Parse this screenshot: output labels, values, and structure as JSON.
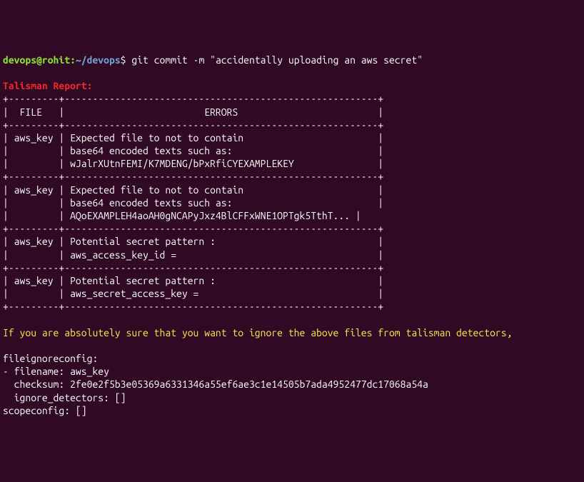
{
  "prompt": {
    "userHost": "devops@rohit",
    "separator": ":",
    "path": "~/devops",
    "dollar": "$ ",
    "command": "git commit -m \"accidentally uploading an aws secret\""
  },
  "report": {
    "header": "Talisman Report:",
    "tableLines": [
      "+---------+--------------------------------------------------------+",
      "|  FILE   |                         ERRORS                         |",
      "+---------+--------------------------------------------------------+",
      "| aws_key | Expected file to not to contain                        |",
      "|         | base64 encoded texts such as:                          |",
      "|         | wJalrXUtnFEMI/K7MDENG/bPxRfiCYEXAMPLEKEY               |",
      "+---------+--------------------------------------------------------+",
      "| aws_key | Expected file to not to contain                        |",
      "|         | base64 encoded texts such as:                          |",
      "|         | AQoEXAMPLEH4aoAH0gNCAPyJxz4BlCFFxWNE1OPTgk5TthT... |",
      "+---------+--------------------------------------------------------+",
      "| aws_key | Potential secret pattern :                             |",
      "|         | aws_access_key_id =                                    |",
      "+---------+--------------------------------------------------------+",
      "| aws_key | Potential secret pattern :                             |",
      "|         | aws_secret_access_key =                                |",
      "+---------+--------------------------------------------------------+"
    ]
  },
  "warning": "If you are absolutely sure that you want to ignore the above files from talisman detectors,",
  "config": {
    "lines": [
      "fileignoreconfig:",
      "- filename: aws_key",
      "  checksum: 2fe0e2f5b3e05369a6331346a55ef6ae3c1e14505b7ada4952477dc17068a54a",
      "  ignore_detectors: []",
      "scopeconfig: []"
    ]
  }
}
